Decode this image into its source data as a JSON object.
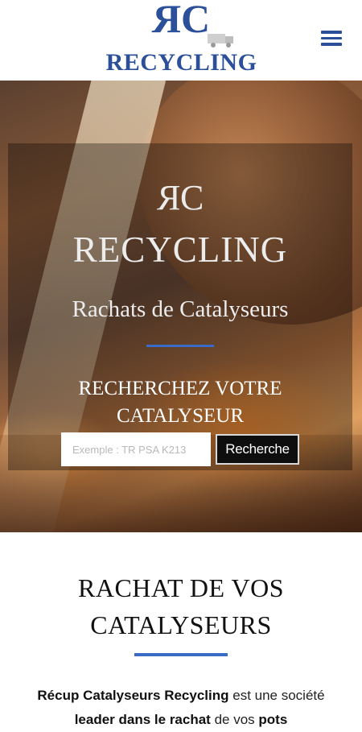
{
  "header": {
    "logo_monogram_left": "R",
    "logo_monogram_right": "C",
    "logo_wordmark": "RECYCLING",
    "menu_icon": "hamburger-menu-icon",
    "accent_color": "#2c4f9a"
  },
  "hero": {
    "monogram_left": "R",
    "monogram_right": "C",
    "title": "RECYCLING",
    "subtitle": "Rachats de Catalyseurs",
    "search_title_line1": "RECHERCHEZ VOTRE",
    "search_title_line2": "CATALYSEUR",
    "search_placeholder": "Exemple : TR PSA K213",
    "search_value": "",
    "search_button": "Recherche",
    "divider_color": "#3a6cc7"
  },
  "about": {
    "title_line1": "RACHAT DE VOS",
    "title_line2": "CATALYSEURS",
    "text_bold1": "Récup Catalyseurs Recycling",
    "text_normal1": " est une société",
    "text_bold2": "leader dans le rachat",
    "text_normal2": " de vos ",
    "text_bold3": "pots"
  }
}
